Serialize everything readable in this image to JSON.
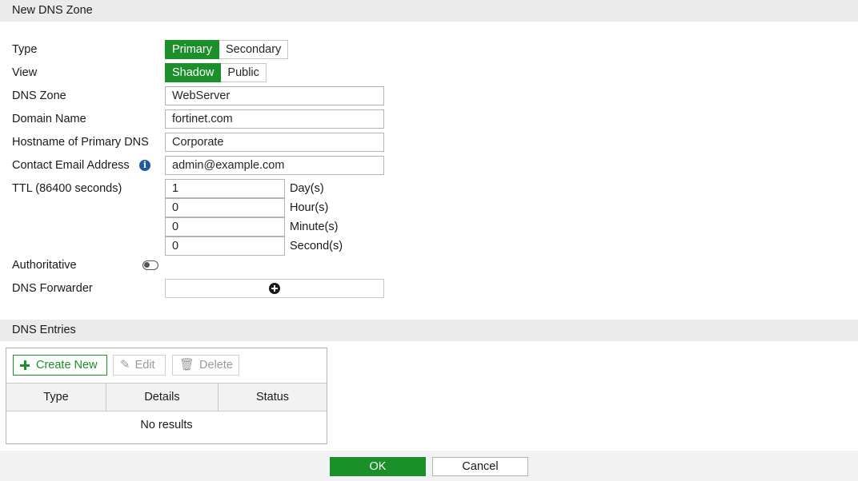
{
  "header": {
    "title": "New DNS Zone"
  },
  "form": {
    "type": {
      "label": "Type",
      "options": [
        "Primary",
        "Secondary"
      ],
      "selected": "Primary"
    },
    "view": {
      "label": "View",
      "options": [
        "Shadow",
        "Public"
      ],
      "selected": "Shadow"
    },
    "dns_zone": {
      "label": "DNS Zone",
      "value": "WebServer"
    },
    "domain_name": {
      "label": "Domain Name",
      "value": "fortinet.com"
    },
    "primary_hostname": {
      "label": "Hostname of Primary DNS",
      "value": "Corporate"
    },
    "contact_email": {
      "label": "Contact Email Address",
      "value": "admin@example.com",
      "icon": "info-icon"
    },
    "ttl": {
      "label": "TTL (86400 seconds)",
      "days": {
        "value": "1",
        "unit": "Day(s)"
      },
      "hours": {
        "value": "0",
        "unit": "Hour(s)"
      },
      "minutes": {
        "value": "0",
        "unit": "Minute(s)"
      },
      "seconds": {
        "value": "0",
        "unit": "Second(s)"
      }
    },
    "authoritative": {
      "label": "Authoritative",
      "enabled": false
    },
    "dns_forwarder": {
      "label": "DNS Forwarder",
      "icon": "plus-circle-icon"
    }
  },
  "entries": {
    "title": "DNS Entries",
    "toolbar": {
      "create": "Create New",
      "edit": "Edit",
      "delete": "Delete"
    },
    "columns": [
      "Type",
      "Details",
      "Status"
    ],
    "empty_text": "No results"
  },
  "footer": {
    "ok": "OK",
    "cancel": "Cancel"
  },
  "colors": {
    "accent": "#1a8f2a",
    "info": "#1d5aa0"
  }
}
